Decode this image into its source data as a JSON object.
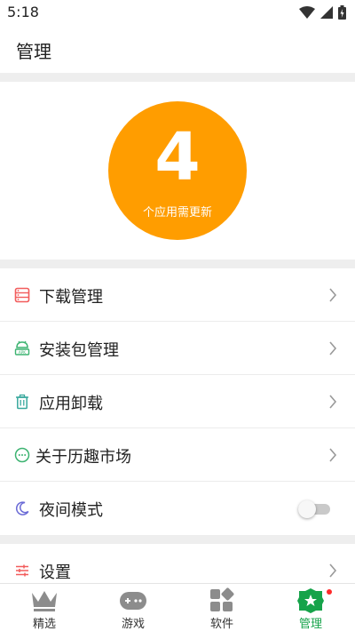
{
  "status_bar": {
    "time": "5:18"
  },
  "app_bar": {
    "title": "管理"
  },
  "hero": {
    "count": "4",
    "label": "个应用需更新",
    "color": "#FF9D00"
  },
  "menu": [
    {
      "label": "下载管理",
      "icon": "download-list-icon",
      "icon_color": "#F25C5C"
    },
    {
      "label": "安装包管理",
      "icon": "apk-android-icon",
      "icon_color": "#3CB371"
    },
    {
      "label": "应用卸载",
      "icon": "trash-icon",
      "icon_color": "#38A89D"
    },
    {
      "label": "关于历趣市场",
      "icon": "chat-bubble-icon",
      "icon_color": "#3CB371"
    },
    {
      "label": "夜间模式",
      "icon": "moon-icon",
      "icon_color": "#6B6BD6",
      "toggle_on": false
    }
  ],
  "settings": {
    "label": "设置",
    "icon": "sliders-icon",
    "icon_color": "#F25C5C"
  },
  "bottom_nav": [
    {
      "label": "精选",
      "icon": "crown-icon",
      "active": false
    },
    {
      "label": "游戏",
      "icon": "gamepad-icon",
      "active": false
    },
    {
      "label": "软件",
      "icon": "apps-grid-icon",
      "active": false
    },
    {
      "label": "管理",
      "icon": "manage-badge-icon",
      "active": true,
      "badge": true
    }
  ],
  "colors": {
    "active_tab": "#16A34A",
    "inactive_icon": "#8C8C8C",
    "badge": "#FF2A2A",
    "band": "#EEEEEE"
  }
}
